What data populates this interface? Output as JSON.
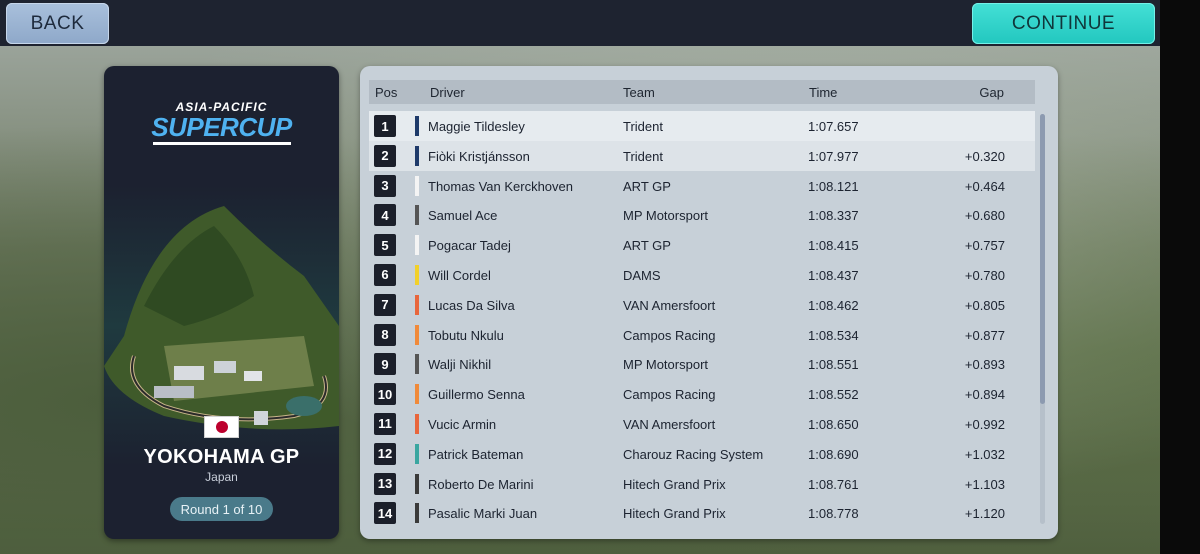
{
  "header": {
    "back_label": "BACK",
    "continue_label": "CONTINUE"
  },
  "event": {
    "series_top": "ASIA-PACIFIC",
    "series_main": "SUPERCUP",
    "gp_name": "YOKOHAMA GP",
    "country": "Japan",
    "round": "Round 1 of 10",
    "flag_icon": "japan-flag-icon"
  },
  "table": {
    "headers": {
      "pos": "Pos",
      "driver": "Driver",
      "team": "Team",
      "time": "Time",
      "gap": "Gap"
    },
    "rows": [
      {
        "pos": "1",
        "driver": "Maggie Tildesley",
        "team": "Trident",
        "time": "1:07.657",
        "gap": "",
        "color": "#1e3a6a"
      },
      {
        "pos": "2",
        "driver": "Fiòki Kristjánsson",
        "team": "Trident",
        "time": "1:07.977",
        "gap": "+0.320",
        "color": "#1e3a6a"
      },
      {
        "pos": "3",
        "driver": "Thomas Van Kerckhoven",
        "team": "ART GP",
        "time": "1:08.121",
        "gap": "+0.464",
        "color": "#f4f4f4"
      },
      {
        "pos": "4",
        "driver": "Samuel Ace",
        "team": "MP Motorsport",
        "time": "1:08.337",
        "gap": "+0.680",
        "color": "#555555"
      },
      {
        "pos": "5",
        "driver": "Pogacar Tadej",
        "team": "ART GP",
        "time": "1:08.415",
        "gap": "+0.757",
        "color": "#f4f4f4"
      },
      {
        "pos": "6",
        "driver": "Will Cordel",
        "team": "DAMS",
        "time": "1:08.437",
        "gap": "+0.780",
        "color": "#f2d02a"
      },
      {
        "pos": "7",
        "driver": "Lucas Da Silva",
        "team": "VAN Amersfoort",
        "time": "1:08.462",
        "gap": "+0.805",
        "color": "#e8663c"
      },
      {
        "pos": "8",
        "driver": "Tobutu Nkulu",
        "team": "Campos Racing",
        "time": "1:08.534",
        "gap": "+0.877",
        "color": "#f08a3a"
      },
      {
        "pos": "9",
        "driver": "Walji Nikhil",
        "team": "MP Motorsport",
        "time": "1:08.551",
        "gap": "+0.893",
        "color": "#555555"
      },
      {
        "pos": "10",
        "driver": "Guillermo Senna",
        "team": "Campos Racing",
        "time": "1:08.552",
        "gap": "+0.894",
        "color": "#f08a3a"
      },
      {
        "pos": "11",
        "driver": "Vucic Armin",
        "team": "VAN Amersfoort",
        "time": "1:08.650",
        "gap": "+0.992",
        "color": "#e8663c"
      },
      {
        "pos": "12",
        "driver": "Patrick Bateman",
        "team": "Charouz Racing System",
        "time": "1:08.690",
        "gap": "+1.032",
        "color": "#3aa6a0"
      },
      {
        "pos": "13",
        "driver": "Roberto De Marini",
        "team": "Hitech Grand Prix",
        "time": "1:08.761",
        "gap": "+1.103",
        "color": "#3a3a3a"
      },
      {
        "pos": "14",
        "driver": "Pasalic Marki Juan",
        "team": "Hitech Grand Prix",
        "time": "1:08.778",
        "gap": "+1.120",
        "color": "#3a3a3a"
      }
    ]
  }
}
